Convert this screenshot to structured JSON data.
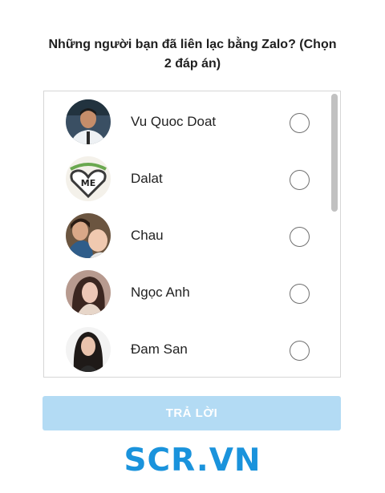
{
  "question": {
    "line1": "Những người bạn đã liên lạc bằng Zalo? (Chọn",
    "line2": "2 đáp án)"
  },
  "contacts": [
    {
      "name": "Vu Quoc Doat",
      "avatar": "man-in-white-shirt-photo",
      "selected": false
    },
    {
      "name": "Dalat",
      "avatar": "heart-me-graphic-photo",
      "selected": false
    },
    {
      "name": "Chau",
      "avatar": "woman-with-child-photo",
      "selected": false
    },
    {
      "name": "Ngọc Anh",
      "avatar": "young-woman-photo",
      "selected": false
    },
    {
      "name": "Đam San",
      "avatar": "woman-long-hair-photo",
      "selected": false
    }
  ],
  "answer_button": {
    "label": "TRẢ LỜI",
    "disabled": true
  },
  "watermark": {
    "text": "SCR.VN"
  },
  "colors": {
    "accent_button_disabled": "#b3dbf4",
    "watermark": "#1a93dc",
    "radio_border": "#6f6f6f",
    "list_border": "#d6d6d6"
  }
}
